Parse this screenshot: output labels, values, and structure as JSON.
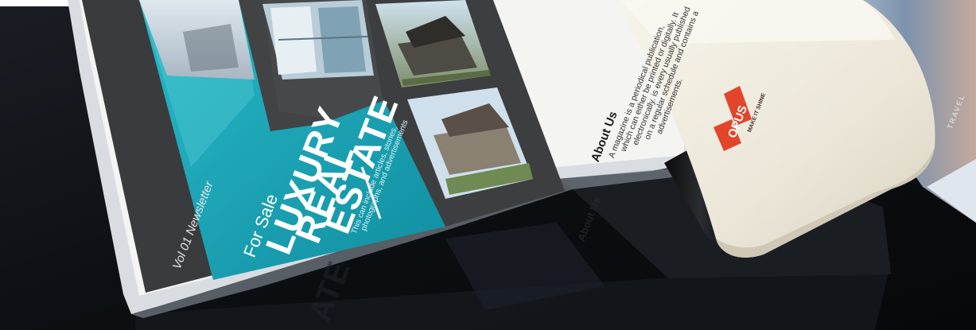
{
  "newsletter": {
    "volume_label": "Vol 01 Newsletter",
    "for_sale": "For Sale",
    "title_line1": "LUXURY",
    "title_line2": "REAL",
    "title_line3": "ESTATE",
    "description_line1": "This can include articles, stories,",
    "description_line2": "photographs, and advertisements",
    "about_heading": "About Us",
    "about_body": [
      "A magazine is a periodical publication,",
      "which can either be printed or digitally. It",
      "electronically. is every usually published",
      "on a regular schedule and contains a",
      "advertisements."
    ]
  },
  "laminator": {
    "brand": "OPUS",
    "brand_sub": "MAKE IT SHINE"
  },
  "background_magazine": {
    "text": "TRAVEL"
  },
  "reflection": {
    "about_text": "About Us",
    "estate_text": "ATE"
  },
  "colors": {
    "cyan": "#19a7b8",
    "dark_teal": "#0b6e7d",
    "felt_gray": "#3c3c3c",
    "laminator_cream": "#efebe0",
    "logo_red": "#e2452a",
    "desk_dark": "#0e1115"
  }
}
